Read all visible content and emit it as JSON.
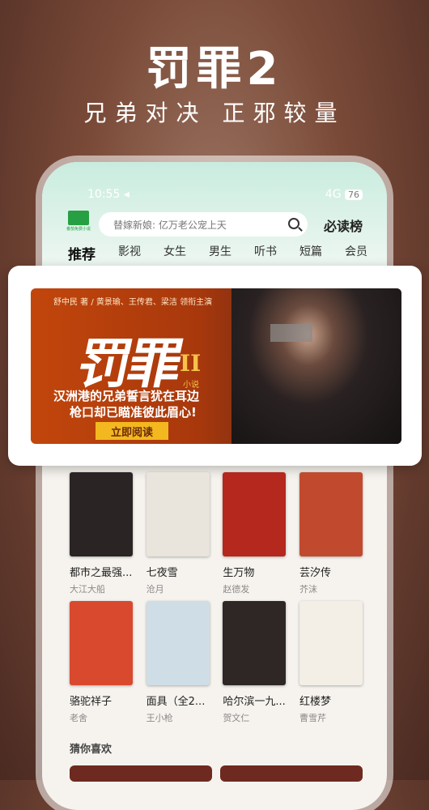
{
  "promo": {
    "headline": "罚罪2",
    "subline": "兄弟对决 正邪较量"
  },
  "status_bar": {
    "time": "10:55 ◂",
    "signal": "4G",
    "battery": "76"
  },
  "app": {
    "logo_text": "番茄免费小说"
  },
  "search": {
    "placeholder": "替嫁新娘: 亿万老公宠上天"
  },
  "ranking_label": "必读榜",
  "tabs": [
    "推荐",
    "影视",
    "女生",
    "男生",
    "听书",
    "短篇",
    "会员"
  ],
  "banner": {
    "credit": "舒中民 著 / 黄景瑜、王传君、梁洁 领衔主演",
    "title_art": "罚罪",
    "title_numeral": "II",
    "title_tag": "小说",
    "tagline_1": "汉洲港的兄弟誓言犹在耳边",
    "tagline_2": "枪口却已瞄准彼此眉心!",
    "cta": "立即阅读",
    "colors": {
      "accent": "#f3b81f",
      "base": "#b8420c"
    }
  },
  "books_row1": [
    {
      "title": "都市之最强...",
      "author": "大江大船",
      "cover": "#2b2424"
    },
    {
      "title": "七夜雪",
      "author": "沧月",
      "cover": "#e9e4dc"
    },
    {
      "title": "生万物",
      "author": "赵德发",
      "cover": "#b5281e"
    },
    {
      "title": "芸汐传",
      "author": "芥沫",
      "cover": "#c14a2e"
    }
  ],
  "books_row2": [
    {
      "title": "骆驼祥子",
      "author": "老舍",
      "cover": "#d9492e"
    },
    {
      "title": "面具（全2...",
      "author": "王小枪",
      "cover": "#cfdde6"
    },
    {
      "title": "哈尔滨一九...",
      "author": "贺文仁",
      "cover": "#2f2626"
    },
    {
      "title": "红楼梦",
      "author": "曹雪芹",
      "cover": "#f3eee6"
    }
  ],
  "section_title": "猜你喜欢"
}
